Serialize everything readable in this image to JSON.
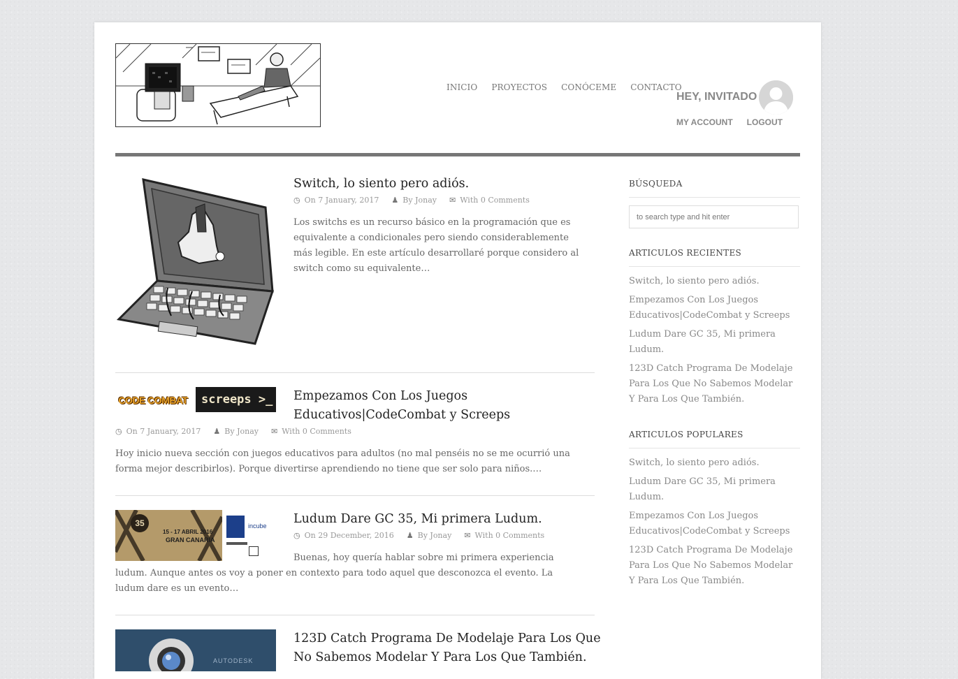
{
  "nav": {
    "items": [
      "INICIO",
      "PROYECTOS",
      "CONÓCEME",
      "CONTACTO"
    ]
  },
  "user": {
    "greeting": "HEY, INVITADO",
    "my_account": "MY ACCOUNT",
    "logout": "LOGOUT"
  },
  "posts": [
    {
      "title": "Switch, lo siento pero adiós.",
      "date": "On 7 January, 2017",
      "author": "By Jonay",
      "comments": "With 0 Comments",
      "excerpt": "Los switchs es un recurso básico en la programación que es equivalente a condicionales pero siendo considerablemente más legible. En este artículo desarrollaré porque considero al switch como su equivalente…"
    },
    {
      "title": "Empezamos Con Los Juegos Educativos|CodeCombat y Screeps",
      "date": "On 7 January, 2017",
      "author": "By Jonay",
      "comments": "With 0 Comments",
      "excerpt": "Hoy inicio nueva sección con juegos educativos para adultos (no mal penséis no se me ocurrió una forma mejor describirlos). Porque divertirse aprendiendo no tiene que ser solo para niños.…",
      "thumb_left": "CODE COMBAT",
      "thumb_right": "screeps >_"
    },
    {
      "title": "Ludum Dare GC 35, Mi primera Ludum.",
      "date": "On 29 December, 2016",
      "author": "By Jonay",
      "comments": "With 0 Comments",
      "excerpt": "Buenas, hoy quería hablar sobre mi primera experiencia ludum. Aunque antes os voy a poner en contexto para todo aquel que desconozca el evento. La ludum dare es un evento…",
      "thumb_dates": "15 - 17 ABRIL 2016",
      "thumb_place": "GRAN CANARIA",
      "thumb_number": "35",
      "thumb_sponsor": "incube"
    },
    {
      "title": "123D Catch Programa De Modelaje Para Los Que No Sabemos Modelar Y Para Los Que También.",
      "thumb_text": "AUTODESK"
    }
  ],
  "sidebar": {
    "search_title": "BÚSQUEDA",
    "search_placeholder": "to search type and hit enter",
    "recent_title": "ARTICULOS RECIENTES",
    "recent": [
      "Switch, lo siento pero adiós.",
      "Empezamos Con Los Juegos Educativos|CodeCombat y Screeps",
      "Ludum Dare GC 35, Mi primera Ludum.",
      "123D Catch Programa De Modelaje Para Los Que No Sabemos Modelar Y Para Los Que También."
    ],
    "popular_title": "ARTICULOS POPULARES",
    "popular": [
      "Switch, lo siento pero adiós.",
      "Ludum Dare GC 35, Mi primera Ludum.",
      "Empezamos Con Los Juegos Educativos|CodeCombat y Screeps",
      "123D Catch Programa De Modelaje Para Los Que No Sabemos Modelar Y Para Los Que También."
    ]
  },
  "colors": {
    "accent_rule": "#777777",
    "title": "#222222",
    "meta": "#999999"
  }
}
